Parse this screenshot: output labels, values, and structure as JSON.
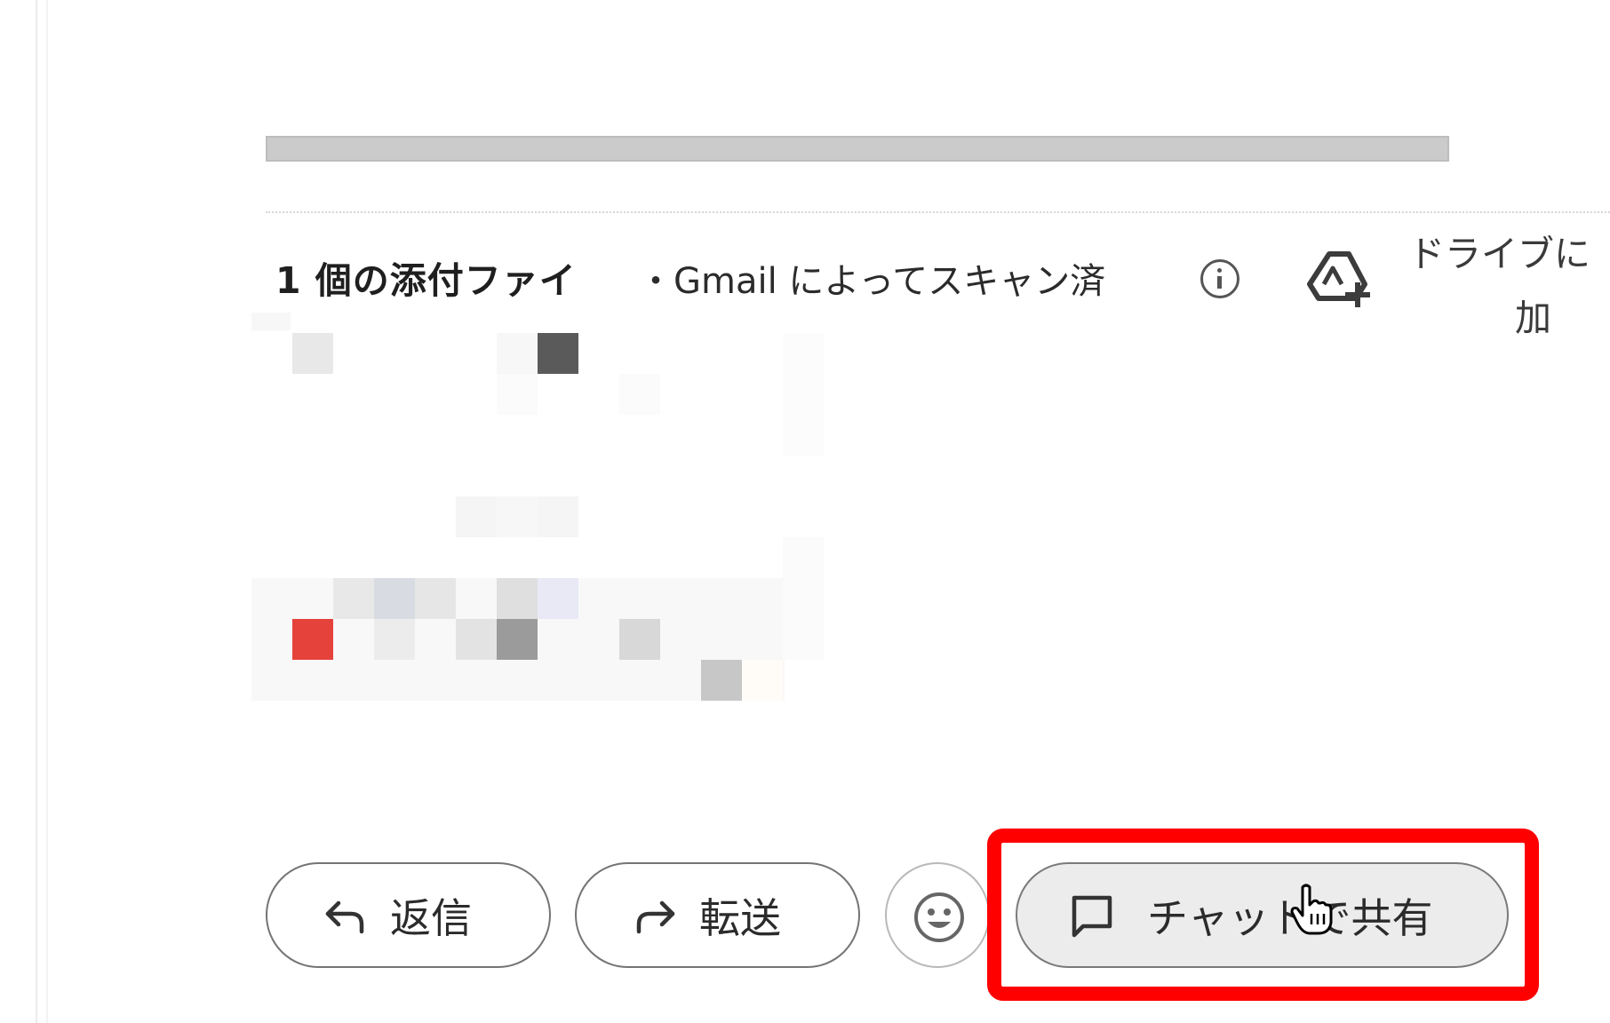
{
  "attachments": {
    "title": "1 個の添付ファイ",
    "scan_status": "・Gmail によってスキャン済",
    "drive_label_line1": "ドライブに",
    "drive_label_line2": "加"
  },
  "actions": {
    "reply_label": "返信",
    "forward_label": "転送",
    "share_chat_label": "チャットで共有"
  },
  "icons": {
    "info": "info-icon",
    "drive_add": "drive-add-icon",
    "reply": "reply-arrow-icon",
    "forward": "forward-arrow-icon",
    "emoji": "emoji-icon",
    "chat": "chat-bubble-icon",
    "cursor": "hand-pointer-cursor"
  },
  "colors": {
    "highlight": "#ff0000",
    "share_button_bg": "#ececec"
  }
}
